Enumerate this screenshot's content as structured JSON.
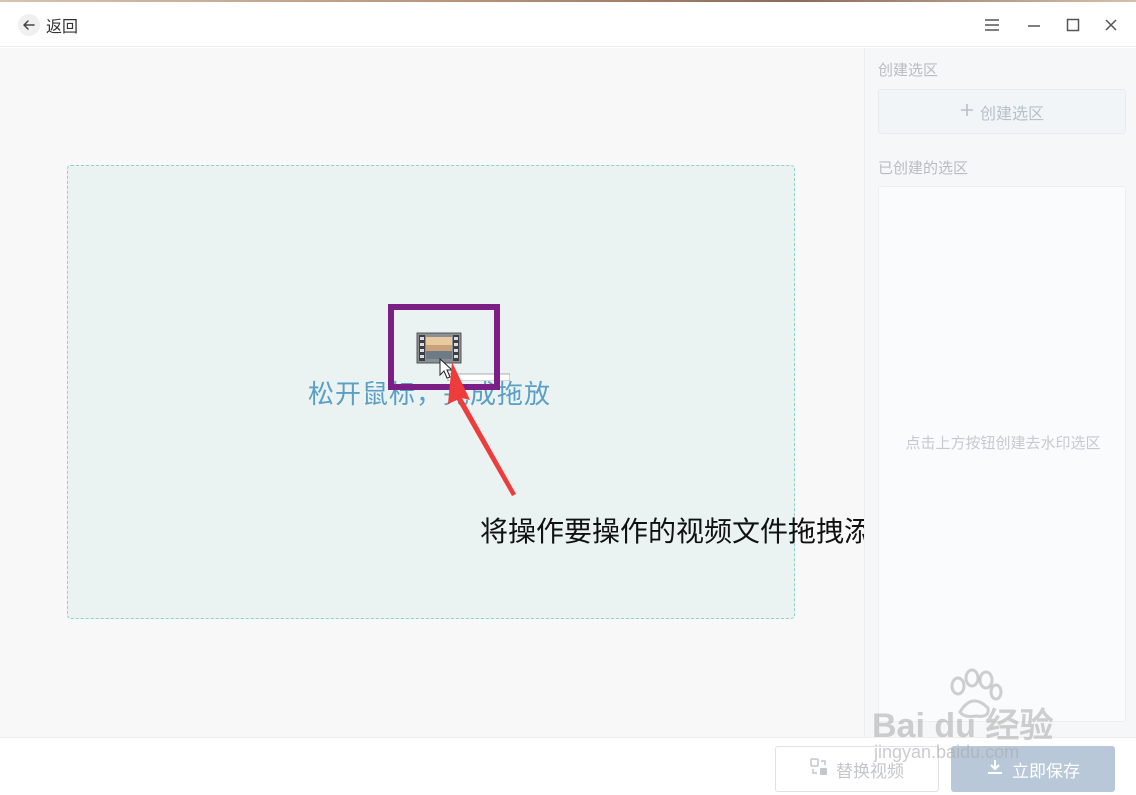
{
  "titlebar": {
    "back_label": "返回",
    "menu_icon": "menu-icon",
    "minimize_icon": "minimize-icon",
    "maximize_icon": "maximize-icon",
    "close_icon": "close-icon"
  },
  "main": {
    "drop_text": "松开鼠标，完成拖放",
    "annotation": "将操作要操作的视频文件拖拽添加",
    "highlight_color": "#7b1f86",
    "arrow_color": "#ee3b3b"
  },
  "sidebar": {
    "create_section_label": "创建选区",
    "create_button_label": "创建选区",
    "created_section_label": "已创建的选区",
    "empty_hint": "点击上方按钮创建去水印选区"
  },
  "footer": {
    "replace_button_label": "替换视频",
    "save_button_label": "立即保存"
  },
  "watermark": {
    "line1": "Bai du 经验",
    "line2": "jingyan.baidu.com"
  },
  "colors": {
    "accent": "#5b9fc4",
    "dropzone_bg": "#eaf3f2",
    "dropzone_border": "#8ed1c6",
    "save_bg": "#b9c8d8"
  }
}
